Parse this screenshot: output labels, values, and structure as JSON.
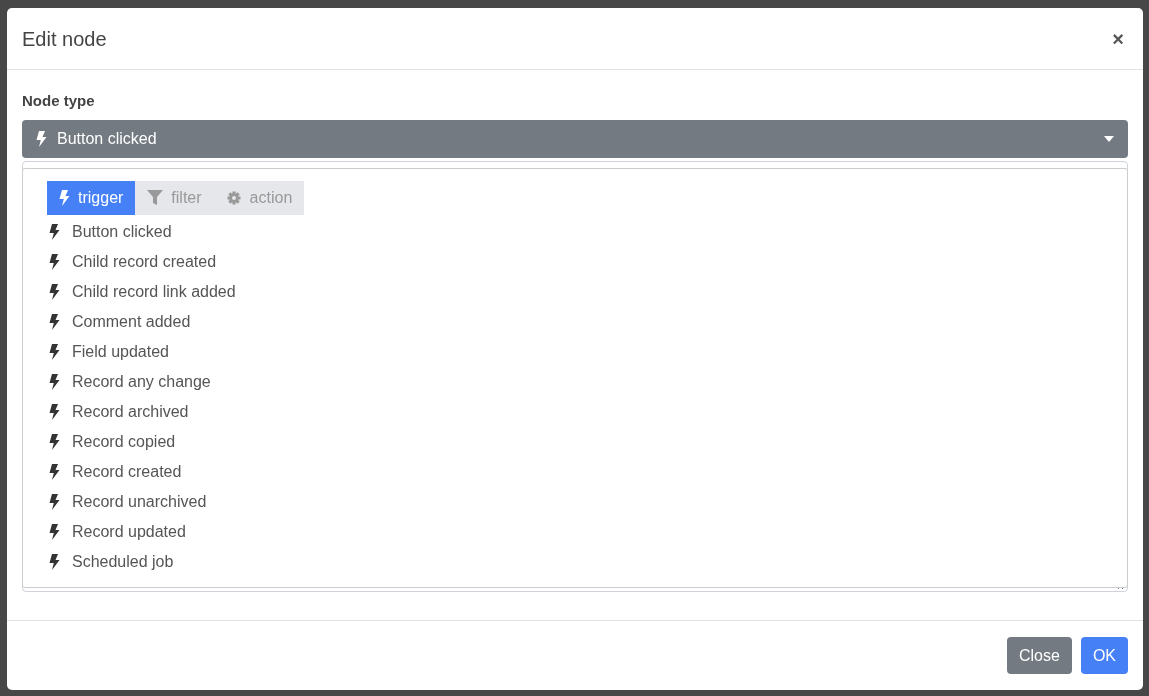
{
  "modal": {
    "title": "Edit node",
    "close_symbol": "×"
  },
  "node_type": {
    "label": "Node type",
    "value": "Button clicked"
  },
  "dropdown": {
    "tabs": [
      {
        "label": "trigger",
        "kind": "trigger",
        "selected": true
      },
      {
        "label": "filter",
        "kind": "filter",
        "selected": false
      },
      {
        "label": "action",
        "kind": "action",
        "selected": false
      }
    ],
    "items": [
      {
        "label": "Button clicked"
      },
      {
        "label": "Child record created"
      },
      {
        "label": "Child record link added"
      },
      {
        "label": "Comment added"
      },
      {
        "label": "Field updated"
      },
      {
        "label": "Record any change"
      },
      {
        "label": "Record archived"
      },
      {
        "label": "Record copied"
      },
      {
        "label": "Record created"
      },
      {
        "label": "Record unarchived"
      },
      {
        "label": "Record updated"
      },
      {
        "label": "Scheduled job"
      }
    ]
  },
  "buttons": [
    {
      "label": "Close",
      "kind": "secondary"
    },
    {
      "label": "OK",
      "kind": "primary"
    }
  ]
}
